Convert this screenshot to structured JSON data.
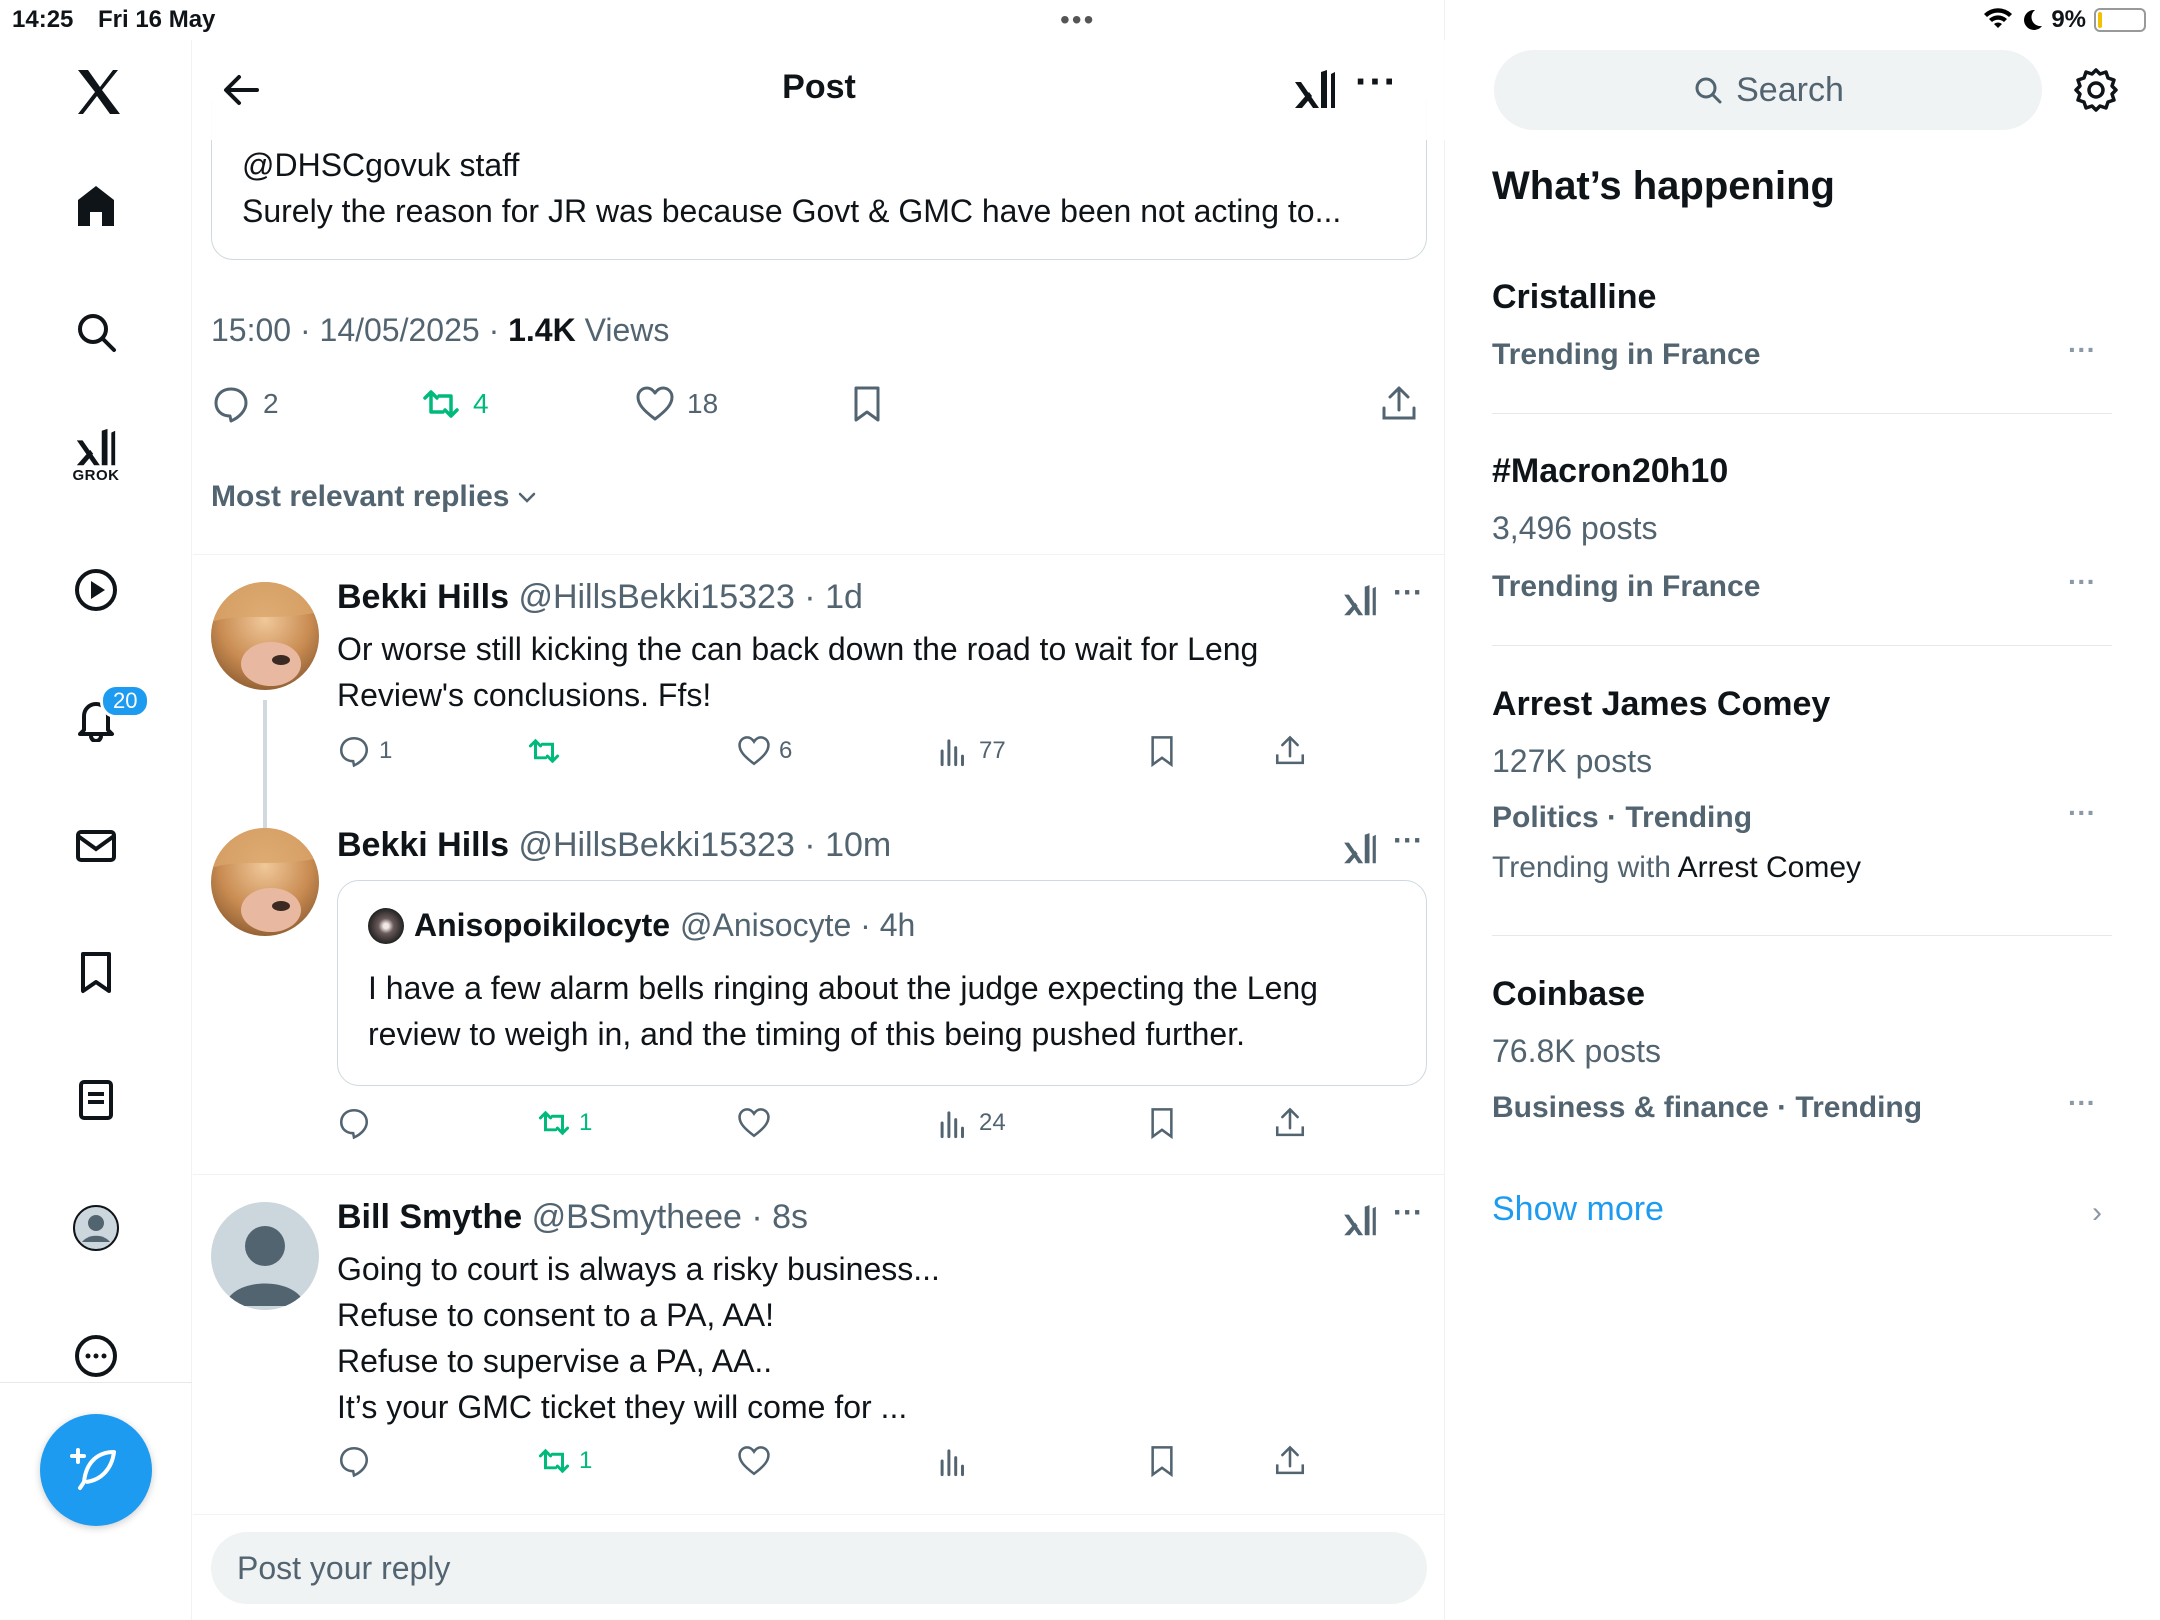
{
  "status": {
    "time": "14:25",
    "date": "Fri 16 May",
    "battery": "9%",
    "battery_level": 0.09
  },
  "nav": {
    "grok_label": "GROK",
    "notifications_badge": "20"
  },
  "header": {
    "title": "Post"
  },
  "quoted": {
    "line1": "@DHSCgovuk staff",
    "line2": "Surely the reason for JR was because Govt & GMC have been not acting to..."
  },
  "post_meta": {
    "time": "15:00",
    "sep": " · ",
    "date": "14/05/2025",
    "sep2": " · ",
    "views_count": "1.4K",
    "views_label": "Views"
  },
  "post_actions": {
    "replies": "2",
    "reposts": "4",
    "likes": "18"
  },
  "sort_label": "Most relevant replies",
  "replies": [
    {
      "name": "Bekki Hills",
      "meta": "@HillsBekki15323 · 1d",
      "lines": [
        "Or worse still kicking the can back down the road to wait for Leng",
        "Review's conclusions. Ffs!"
      ],
      "replies": "1",
      "reposts": "",
      "likes": "6",
      "views": "77"
    },
    {
      "name": "Bekki Hills",
      "meta": "@HillsBekki15323 · 10m",
      "quote": {
        "name": "Anisopoikilocyte",
        "meta": "@Anisocyte · 4h",
        "lines": [
          "I have a few alarm bells ringing about the judge expecting the Leng",
          "review to weigh in, and the timing of this being pushed further."
        ]
      },
      "replies": "",
      "reposts": "1",
      "likes": "",
      "views": "24"
    },
    {
      "name": "Bill Smythe",
      "meta": "@BSmytheee · 8s",
      "lines": [
        "Going to court is always a risky business...",
        "Refuse to consent to a PA, AA!",
        "Refuse to supervise a PA, AA..",
        "It’s your GMC ticket they will come for ..."
      ],
      "replies": "",
      "reposts": "1",
      "likes": "",
      "views": ""
    }
  ],
  "reply_placeholder": "Post your reply",
  "sidebar": {
    "search_placeholder": "Search",
    "heading": "What’s happening",
    "trends": [
      {
        "title": "Cristalline",
        "category": "Trending in France"
      },
      {
        "title": "#Macron20h10",
        "posts": "3,496 posts",
        "category": "Trending in France"
      },
      {
        "title": "Arrest James Comey",
        "posts": "127K posts",
        "category": "Politics · Trending",
        "with_prefix": "Trending with ",
        "with_name": "Arrest Comey"
      },
      {
        "title": "Coinbase",
        "posts": "76.8K posts",
        "category": "Business & finance · Trending"
      }
    ],
    "show_more": "Show more"
  },
  "colors": {
    "accent": "#1d9bf0",
    "repost_green": "#00ba7c",
    "muted": "#536471"
  }
}
